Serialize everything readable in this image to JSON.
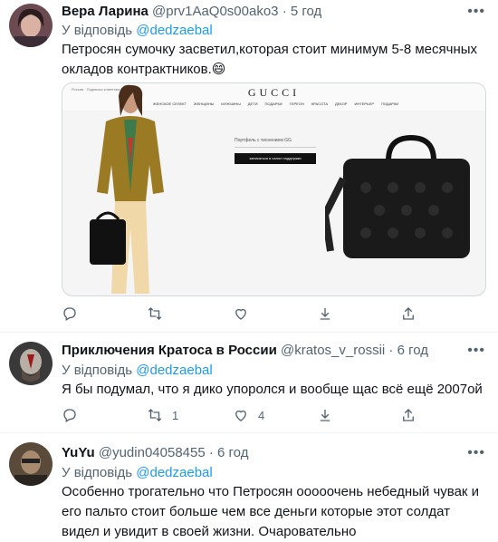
{
  "colors": {
    "link": "#1d9bf0",
    "muted": "#536471",
    "text": "#0f1419",
    "divider": "#eff3f4"
  },
  "tweets": [
    {
      "name": "Вера Ларина",
      "handle": "@prv1AaQ0s00ako3",
      "time": "5 год",
      "reply_prefix": "У відповідь",
      "reply_mention": "@dedzaebal",
      "text": "Петросян сумочку засветил,которая стоит минимум 5-8 месячных окладов контрактников.😄",
      "actions": {
        "reply": "",
        "retweet": "",
        "like": "",
        "share": ""
      }
    },
    {
      "name": "Приключения Кратоса в России",
      "handle": "@kratos_v_rossii",
      "time": "6 год",
      "reply_prefix": "У відповідь",
      "reply_mention": "@dedzaebal",
      "text": "Я бы подумал, что я дико упоролся и вообще щас всё ещё 2007ой",
      "actions": {
        "reply": "",
        "retweet": "1",
        "like": "4",
        "share": ""
      }
    },
    {
      "name": "YuYu",
      "handle": "@yudin04058455",
      "time": "6 год",
      "reply_prefix": "У відповідь",
      "reply_mention": "@dedzaebal",
      "text": "Особенно трогательно что Петросян ооооочень небедный чувак и его пальто стоит больше чем все деньги которые этот солдат видел и увидит в своей жизни. Очаровательно"
    }
  ],
  "media": {
    "logo": "GUCCI",
    "top_left": "Россия · Подписка клиентам",
    "menu": [
      "ЖЕНСКОЕ СЕЛЕКТ",
      "ЖЕНЩИНЫ",
      "МУЖЧИНЫ",
      "ДЕТИ",
      "ПОДАРКИ",
      "ГЕРЕОН",
      "КРАСОТА",
      "ДЕКОР",
      "ИНТЕРЬЕР",
      "ПОДАРКИ"
    ],
    "search_label": "Портфель с тиснением GG",
    "button_label": "записаться в салон поддержки"
  }
}
